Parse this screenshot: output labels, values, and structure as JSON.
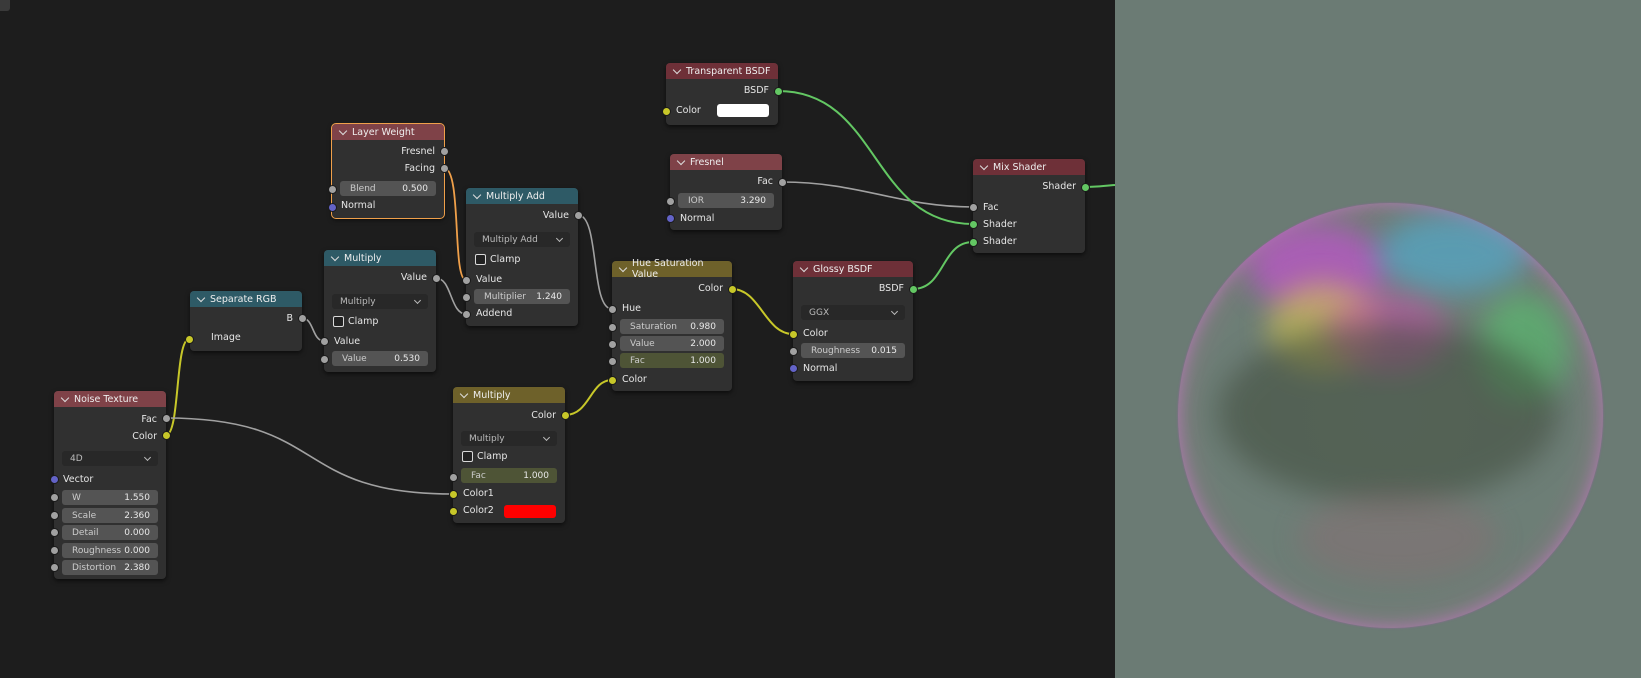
{
  "nodes": {
    "noise_texture": {
      "title": "Noise Texture",
      "outputs": [
        "Fac",
        "Color"
      ],
      "dimensions": "4D",
      "vector_label": "Vector",
      "fields": [
        {
          "label": "W",
          "value": "1.550"
        },
        {
          "label": "Scale",
          "value": "2.360"
        },
        {
          "label": "Detail",
          "value": "0.000"
        },
        {
          "label": "Roughness",
          "value": "0.000"
        },
        {
          "label": "Distortion",
          "value": "2.380"
        }
      ]
    },
    "separate_rgb": {
      "title": "Separate RGB",
      "output": "B",
      "input": "Image"
    },
    "multiply_math": {
      "title": "Multiply",
      "output": "Value",
      "operation": "Multiply",
      "clamp": "Clamp",
      "input": "Value",
      "field_label": "Value",
      "field_value": "0.530"
    },
    "layer_weight": {
      "title": "Layer Weight",
      "outputs": [
        "Fresnel",
        "Facing"
      ],
      "blend_label": "Blend",
      "blend_value": "0.500",
      "normal": "Normal"
    },
    "multiply_add": {
      "title": "Multiply Add",
      "output": "Value",
      "operation": "Multiply Add",
      "clamp": "Clamp",
      "input": "Value",
      "multiplier_label": "Multiplier",
      "multiplier_value": "1.240",
      "addend": "Addend"
    },
    "multiply_mix": {
      "title": "Multiply",
      "output": "Color",
      "operation": "Multiply",
      "clamp": "Clamp",
      "fac_label": "Fac",
      "fac_value": "1.000",
      "color1": "Color1",
      "color2": "Color2",
      "color2_value": "#ff0000"
    },
    "transparent_bsdf": {
      "title": "Transparent BSDF",
      "output": "BSDF",
      "input": "Color",
      "color_value": "#ffffff"
    },
    "fresnel": {
      "title": "Fresnel",
      "output": "Fac",
      "ior_label": "IOR",
      "ior_value": "3.290",
      "normal": "Normal"
    },
    "hue_sat": {
      "title": "Hue Saturation Value",
      "output": "Color",
      "hue": "Hue",
      "saturation_label": "Saturation",
      "saturation_value": "0.980",
      "value_label": "Value",
      "value_value": "2.000",
      "fac_label": "Fac",
      "fac_value": "1.000",
      "color": "Color"
    },
    "glossy_bsdf": {
      "title": "Glossy BSDF",
      "output": "BSDF",
      "distribution": "GGX",
      "color": "Color",
      "roughness_label": "Roughness",
      "roughness_value": "0.015",
      "normal": "Normal"
    },
    "mix_shader": {
      "title": "Mix Shader",
      "output": "Shader",
      "inputs": [
        "Fac",
        "Shader",
        "Shader"
      ]
    }
  },
  "colors": {
    "background": "#1d1d1d",
    "viewport": "#6b7b74",
    "link_gray": "#a1a1a1",
    "link_yellow": "#c7c729",
    "link_green": "#63c763",
    "link_selected": "#f0a04a"
  }
}
